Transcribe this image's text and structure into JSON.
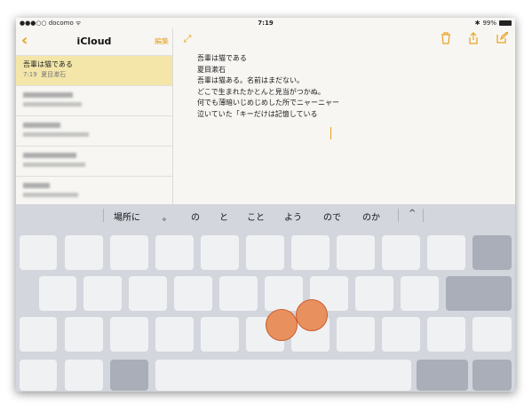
{
  "status_bar": {
    "carrier": "●●●○○ docomo ᯤ",
    "time": "7:19",
    "battery": "99%"
  },
  "sidebar": {
    "title": "iCloud",
    "edit_label": "編集",
    "notes": [
      {
        "title": "吾輩は猫である",
        "time": "7:19",
        "preview": "夏目漱石"
      }
    ]
  },
  "note": {
    "lines": [
      "吾輩は猫である",
      "夏目漱石",
      "吾輩は猫ある。名前はまだない。",
      "どこで生まれたかとんと見当がつかぬ。",
      "何でも薄暗いじめじめした所でニャーニャー",
      "泣いていた「キーだけは記憶している"
    ]
  },
  "keyboard": {
    "suggestions": [
      "場所に",
      "。",
      "の",
      "と",
      "こと",
      "よう",
      "ので",
      "のか"
    ],
    "collapse_glyph": "^"
  },
  "colors": {
    "accent": "#e7a21c",
    "selected_note": "#f3e6a8",
    "touch": "#e9915e"
  }
}
